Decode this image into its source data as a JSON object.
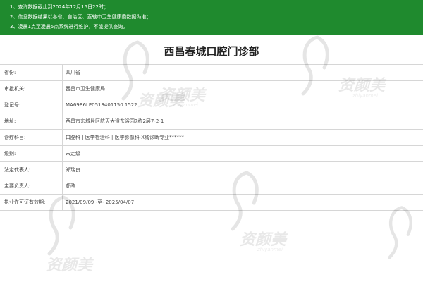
{
  "notice": {
    "line1": "1、查询数据截止到2024年12月15日22时；",
    "line2": "2、信息数据结果以各省、自治区、直辖市卫生健康委数据为准；",
    "line3": "3、凌晨1点至凌晨5点系统进行维护，不能提供查询。"
  },
  "title": "西昌春城口腔门诊部",
  "rows": [
    {
      "label": "省份:",
      "value": "四川省"
    },
    {
      "label": "审批机关:",
      "value": "西昌市卫生健康局"
    },
    {
      "label": "登记号:",
      "value": "MA69B6LP0513401150 1522"
    },
    {
      "label": "地址:",
      "value": "西昌市东城片区航天大道东浴园7栋2层7-2-1"
    },
    {
      "label": "诊疗科目:",
      "value": "口腔科 | 医学检验科 | 医学影像科-X线诊断专业******"
    },
    {
      "label": "级别:",
      "value": "未定级"
    },
    {
      "label": "法定代表人:",
      "value": "郑瑞良"
    },
    {
      "label": "主要负责人:",
      "value": "郝政"
    },
    {
      "label": "执业许可证有效期:",
      "value": "2021/09/09 -至- 2025/04/07"
    }
  ],
  "watermark": {
    "text": "资颜美",
    "sub": "zhiyanmei"
  }
}
